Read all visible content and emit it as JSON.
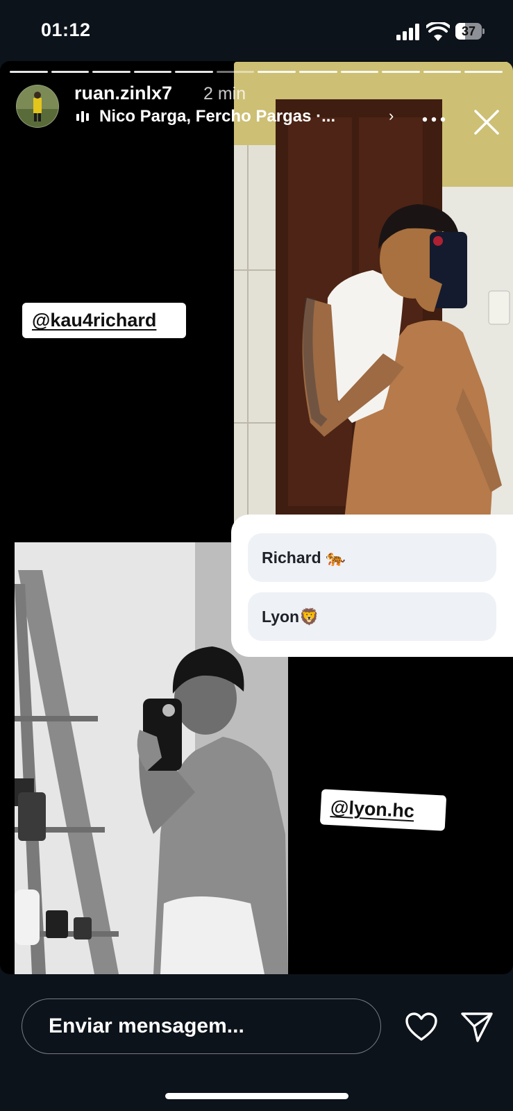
{
  "status_bar": {
    "time": "01:12",
    "battery_level": "37"
  },
  "story": {
    "username": "ruan.zinlx7",
    "time_ago": "2 min",
    "music": "Nico Parga, Fercho Pargas ·...",
    "progress": {
      "total_segments": 12,
      "current_segment": 6
    },
    "mentions": [
      "@kau4richard",
      "@lyon.hc"
    ],
    "poll_options": [
      "Richard 🐅",
      "Lyon🦁"
    ],
    "icons": {
      "close": "close-icon",
      "more": "more-icon",
      "music": "music-icon",
      "chevron": "chevron-right-icon"
    }
  },
  "bottom_bar": {
    "message_placeholder": "Enviar mensagem...",
    "icons": {
      "like": "heart-icon",
      "share": "send-icon"
    }
  }
}
